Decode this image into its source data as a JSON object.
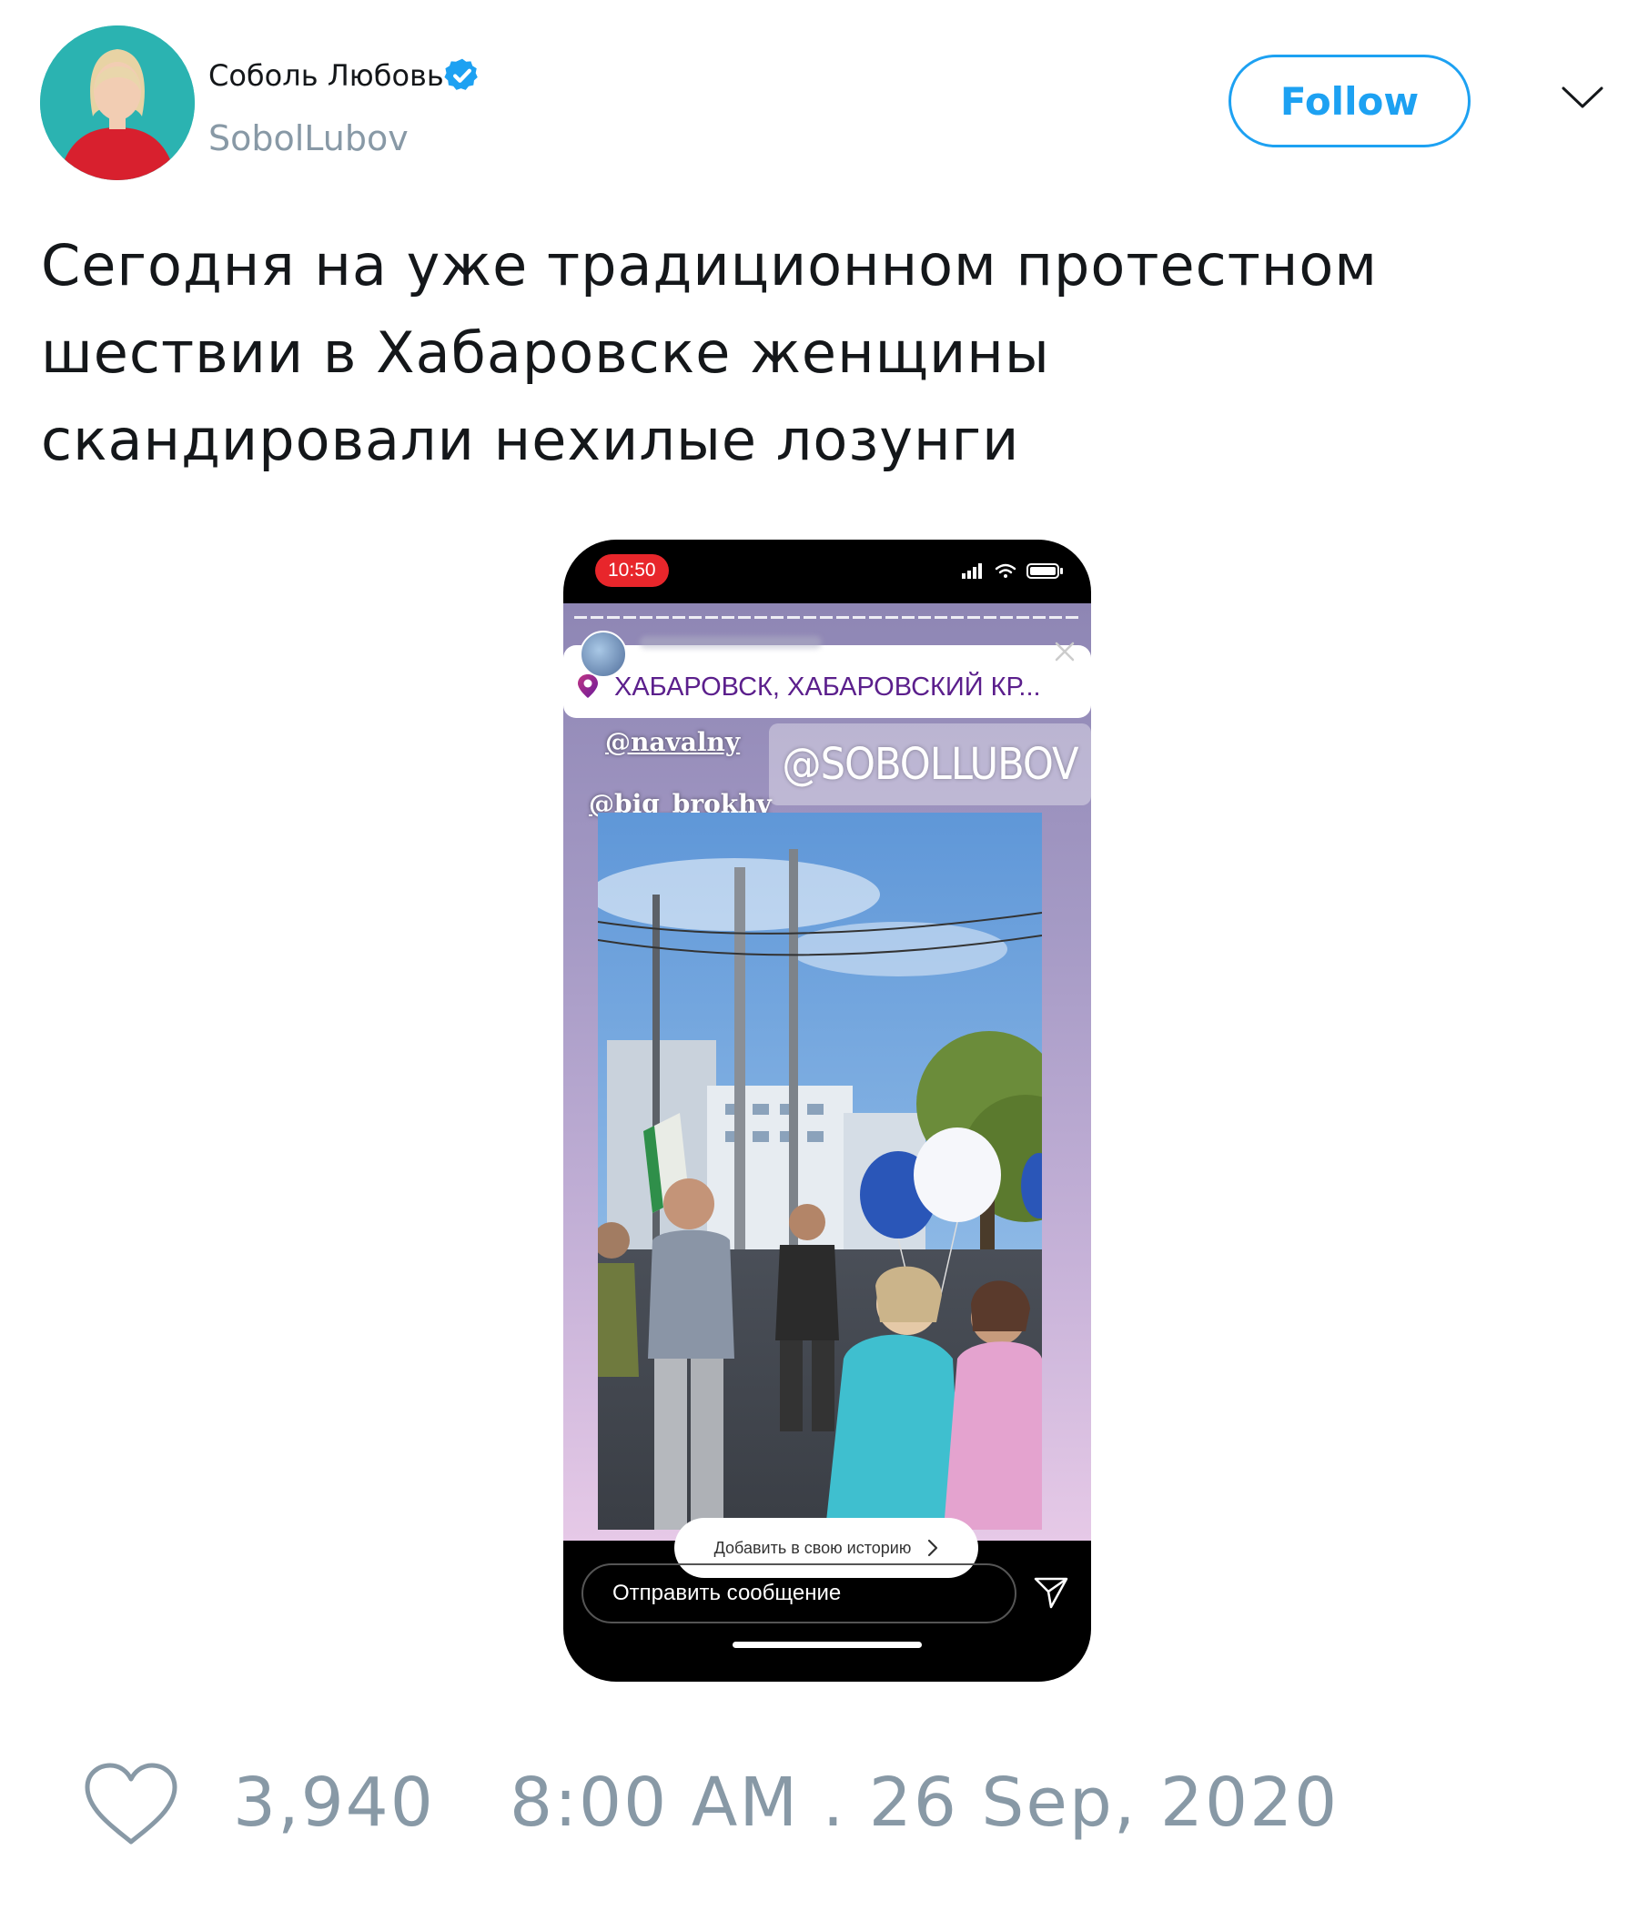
{
  "author": {
    "name": "Соболь Любовь",
    "handle": "SobolLubov",
    "verified": true
  },
  "actions": {
    "follow_label": "Follow"
  },
  "tweet": {
    "text_lines": [
      "Сегодня на уже традиционном протестном",
      "шествии в Хабаровске женщины",
      "скандировали нехилые лозунги"
    ]
  },
  "media": {
    "status_time": "10:50",
    "location": "ХАБАРОВСК, ХАБАРОВСКИЙ КР...",
    "mentions": [
      "@navalny",
      "@big_brokhv",
      "@SOBOLLUBOV"
    ],
    "add_story_label": "Добавить в свою историю",
    "message_placeholder": "Отправить сообщение"
  },
  "footer": {
    "like_count": "3,940",
    "timestamp": "8:00 AM . 26 Sep, 2020"
  },
  "colors": {
    "accent": "#1da1f2",
    "muted": "#8899a6",
    "text": "#14171a",
    "location_text": "#5b1f8c",
    "recording_badge": "#e8262b"
  }
}
